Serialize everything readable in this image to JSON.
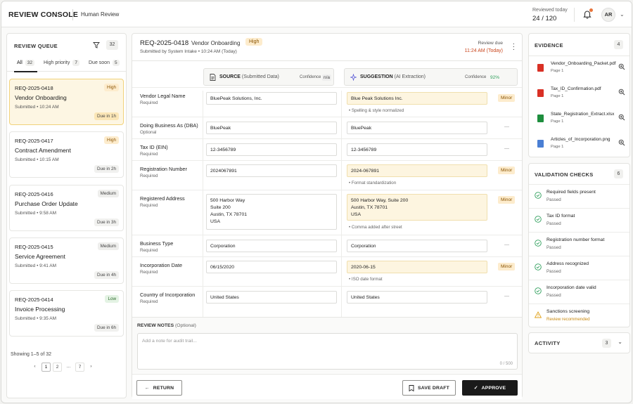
{
  "header": {
    "brand": "REVIEW CONSOLE",
    "subtitle": "Human Review",
    "reviewed_label": "Reviewed today",
    "reviewed_value": "24 / 120",
    "avatar_initials": "AR"
  },
  "queue": {
    "title": "REVIEW QUEUE",
    "count": "32",
    "tabs": [
      {
        "label": "All",
        "count": "32"
      },
      {
        "label": "High priority",
        "count": "7"
      },
      {
        "label": "Due soon",
        "count": "5"
      }
    ],
    "items": [
      {
        "id": "REQ-2025-0418",
        "title": "Vendor Onboarding",
        "submitted": "Submitted • 10:24 AM",
        "priority": "High",
        "due": "Due in 1h"
      },
      {
        "id": "REQ-2025-0417",
        "title": "Contract Amendment",
        "submitted": "Submitted • 10:15 AM",
        "priority": "High",
        "due": "Due in 2h"
      },
      {
        "id": "REQ-2025-0416",
        "title": "Purchase Order Update",
        "submitted": "Submitted • 9:58 AM",
        "priority": "Medium",
        "due": "Due in 3h"
      },
      {
        "id": "REQ-2025-0415",
        "title": "Service Agreement",
        "submitted": "Submitted • 9:41 AM",
        "priority": "Medium",
        "due": "Due in 4h"
      },
      {
        "id": "REQ-2025-0414",
        "title": "Invoice Processing",
        "submitted": "Submitted • 9:35 AM",
        "priority": "Low",
        "due": "Due in 6h"
      }
    ],
    "showing": "Showing 1–5 of 32",
    "pages": [
      "‹",
      "1",
      "2",
      "...",
      "7",
      "›"
    ]
  },
  "request": {
    "id": "REQ-2025-0418",
    "type": "Vendor Onboarding",
    "priority": "High",
    "submitted_by": "Submitted by System Intake  •  10:24 AM (Today)",
    "due_label": "Review due",
    "due_value": "11:24 AM (Today)"
  },
  "columns": {
    "source_title": "SOURCE",
    "source_sub": "(Submitted Data)",
    "source_conf_label": "Confidence",
    "source_conf": "n/a",
    "suggestion_title": "SUGGESTION",
    "suggestion_sub": "(AI Extraction)",
    "suggestion_conf_label": "Confidence",
    "suggestion_conf": "92%"
  },
  "fields": [
    {
      "label": "Vendor Legal Name",
      "req": "Required",
      "source": "BluePeak Solutions, Inc.",
      "suggestion": "Blue Peak Solutions Inc.",
      "changed": true,
      "badge": "Minor",
      "note": "• Spelling & style normalized"
    },
    {
      "label": "Doing Business As (DBA)",
      "req": "Optional",
      "source": "BluePeak",
      "suggestion": "BluePeak",
      "changed": false,
      "badge": "—",
      "note": ""
    },
    {
      "label": "Tax ID (EIN)",
      "req": "Required",
      "source": "12-3456789",
      "suggestion": "12-3456789",
      "changed": false,
      "badge": "—",
      "note": ""
    },
    {
      "label": "Registration Number",
      "req": "Required",
      "source": "2024067891",
      "suggestion": "2024-067891",
      "changed": true,
      "badge": "Minor",
      "note": "• Format standardization"
    },
    {
      "label": "Registered Address",
      "req": "Required",
      "source": "500 Harbor Way\nSuite 200\nAustin, TX 78701\nUSA",
      "suggestion": "500 Harbor Way, Suite 200\nAustin, TX 78701\nUSA",
      "changed": true,
      "badge": "Minor",
      "note": "• Comma added after street"
    },
    {
      "label": "Business Type",
      "req": "Required",
      "source": "Corporation",
      "suggestion": "Corporation",
      "changed": false,
      "badge": "—",
      "note": ""
    },
    {
      "label": "Incorporation Date",
      "req": "Required",
      "source": "06/15/2020",
      "suggestion": "2020-06-15",
      "changed": true,
      "badge": "Minor",
      "note": "• ISO date format"
    },
    {
      "label": "Country of Incorporation",
      "req": "Required",
      "source": "United States",
      "suggestion": "United States",
      "changed": false,
      "badge": "—",
      "note": ""
    }
  ],
  "notes": {
    "label": "REVIEW NOTES",
    "label_sub": "(Optional)",
    "placeholder": "Add a note for audit trail...",
    "counter": "0 / 500"
  },
  "actions": {
    "return": "RETURN",
    "save_draft": "SAVE DRAFT",
    "approve": "APPROVE"
  },
  "evidence": {
    "title": "EVIDENCE",
    "count": "4",
    "files": [
      {
        "name": "Vendor_Onboarding_Packet.pdf",
        "page": "Page 1",
        "icon": "pdf-icon",
        "color": "#d93025"
      },
      {
        "name": "Tax_ID_Confirmation.pdf",
        "page": "Page 1",
        "icon": "pdf-icon",
        "color": "#d93025"
      },
      {
        "name": "State_Registration_Extract.xlsx",
        "page": "Page 1",
        "icon": "spreadsheet-icon",
        "color": "#1e8e3e"
      },
      {
        "name": "Articles_of_Incorporation.png",
        "page": "Page 1",
        "icon": "image-icon",
        "color": "#4a7fd4"
      }
    ]
  },
  "validation": {
    "title": "VALIDATION CHECKS",
    "count": "6",
    "checks": [
      {
        "name": "Required fields present",
        "status": "Passed",
        "kind": "pass"
      },
      {
        "name": "Tax ID format",
        "status": "Passed",
        "kind": "pass"
      },
      {
        "name": "Registration number format",
        "status": "Passed",
        "kind": "pass"
      },
      {
        "name": "Address recognized",
        "status": "Passed",
        "kind": "pass"
      },
      {
        "name": "Incorporation date valid",
        "status": "Passed",
        "kind": "pass"
      },
      {
        "name": "Sanctions screening",
        "status": "Review recommended",
        "kind": "warn"
      }
    ]
  },
  "activity": {
    "title": "ACTIVITY",
    "count": "3"
  },
  "colors": {
    "accent_warn": "#c9471e",
    "pass": "#2e9e5b",
    "warn": "#e0a21a",
    "highlight": "#fdf5e0"
  }
}
